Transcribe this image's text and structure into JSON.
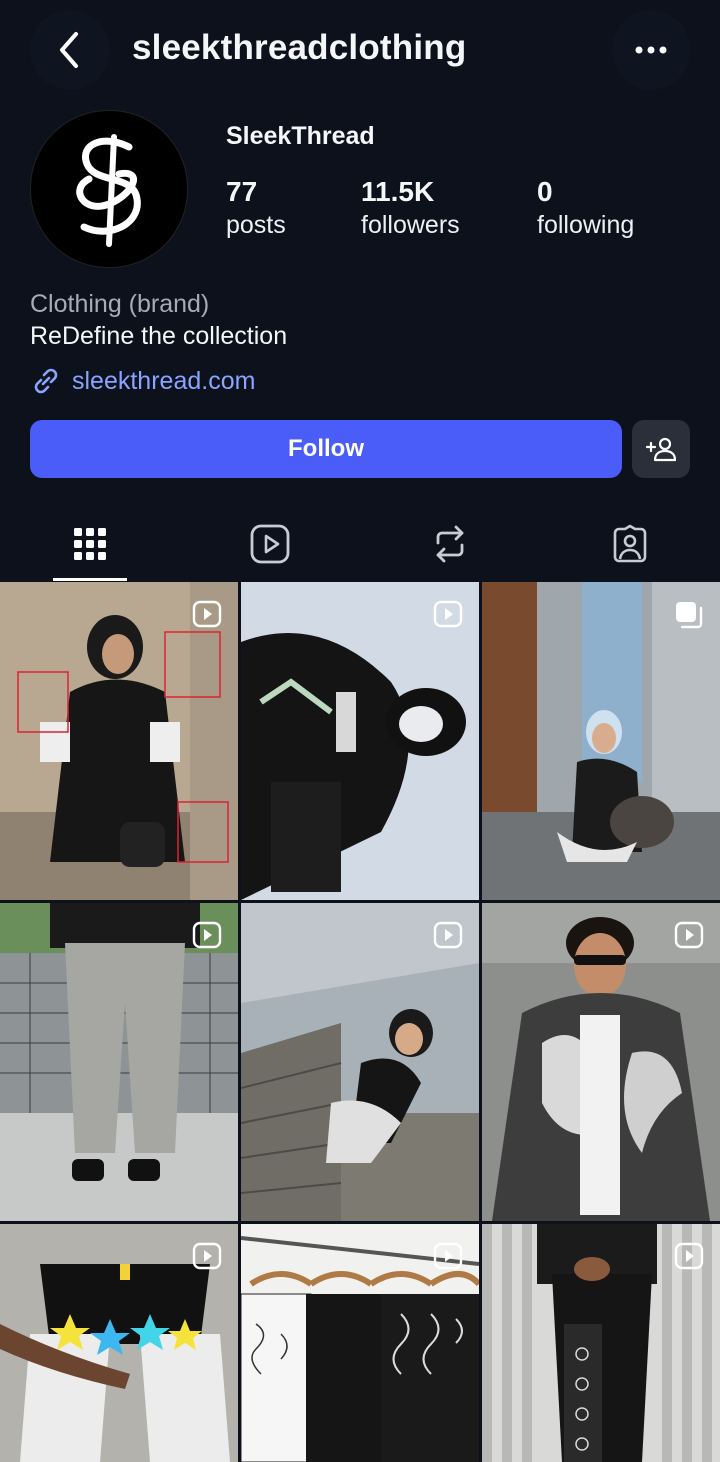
{
  "header": {
    "username": "sleekthreadclothing",
    "back_icon": "chevron-left-icon",
    "more_icon": "more-horizontal-icon"
  },
  "profile": {
    "display_name": "SleekThread",
    "category": "Clothing (brand)",
    "bio": "ReDefine the collection",
    "link": "sleekthread.com",
    "stats": {
      "posts": {
        "value": "77",
        "label": "posts"
      },
      "followers": {
        "value": "11.5K",
        "label": "followers"
      },
      "following": {
        "value": "0",
        "label": "following"
      }
    }
  },
  "actions": {
    "follow_label": "Follow",
    "suggest_icon": "add-person-icon"
  },
  "tabs": [
    {
      "icon": "grid-icon",
      "selected": true
    },
    {
      "icon": "reels-icon",
      "selected": false
    },
    {
      "icon": "reposts-icon",
      "selected": false
    },
    {
      "icon": "tagged-icon",
      "selected": false
    }
  ],
  "posts": [
    {
      "type": "reel",
      "subject": "woman in headphones and black hijab with graphic sleeves"
    },
    {
      "type": "reel",
      "subject": "low-angle shot of figure in black with white face mask"
    },
    {
      "type": "carousel",
      "subject": "woman in headscarf crouching with handbag"
    },
    {
      "type": "reel",
      "subject": "grey cargo pants by tennis net"
    },
    {
      "type": "reel",
      "subject": "woman in sunglasses on stairs, overhead view"
    },
    {
      "type": "reel",
      "subject": "young man in sunglasses and marble-print shirt"
    },
    {
      "type": "reel",
      "subject": "black shorts with colorful star patches"
    },
    {
      "type": "reel",
      "subject": "printed shirts on wooden hangers"
    },
    {
      "type": "reel",
      "subject": "person in black with bandana-print pants"
    }
  ],
  "colors": {
    "background": "#0c111c",
    "accent": "#4a5df9",
    "link": "#8aa4ff",
    "muted": "#a6abb6"
  }
}
